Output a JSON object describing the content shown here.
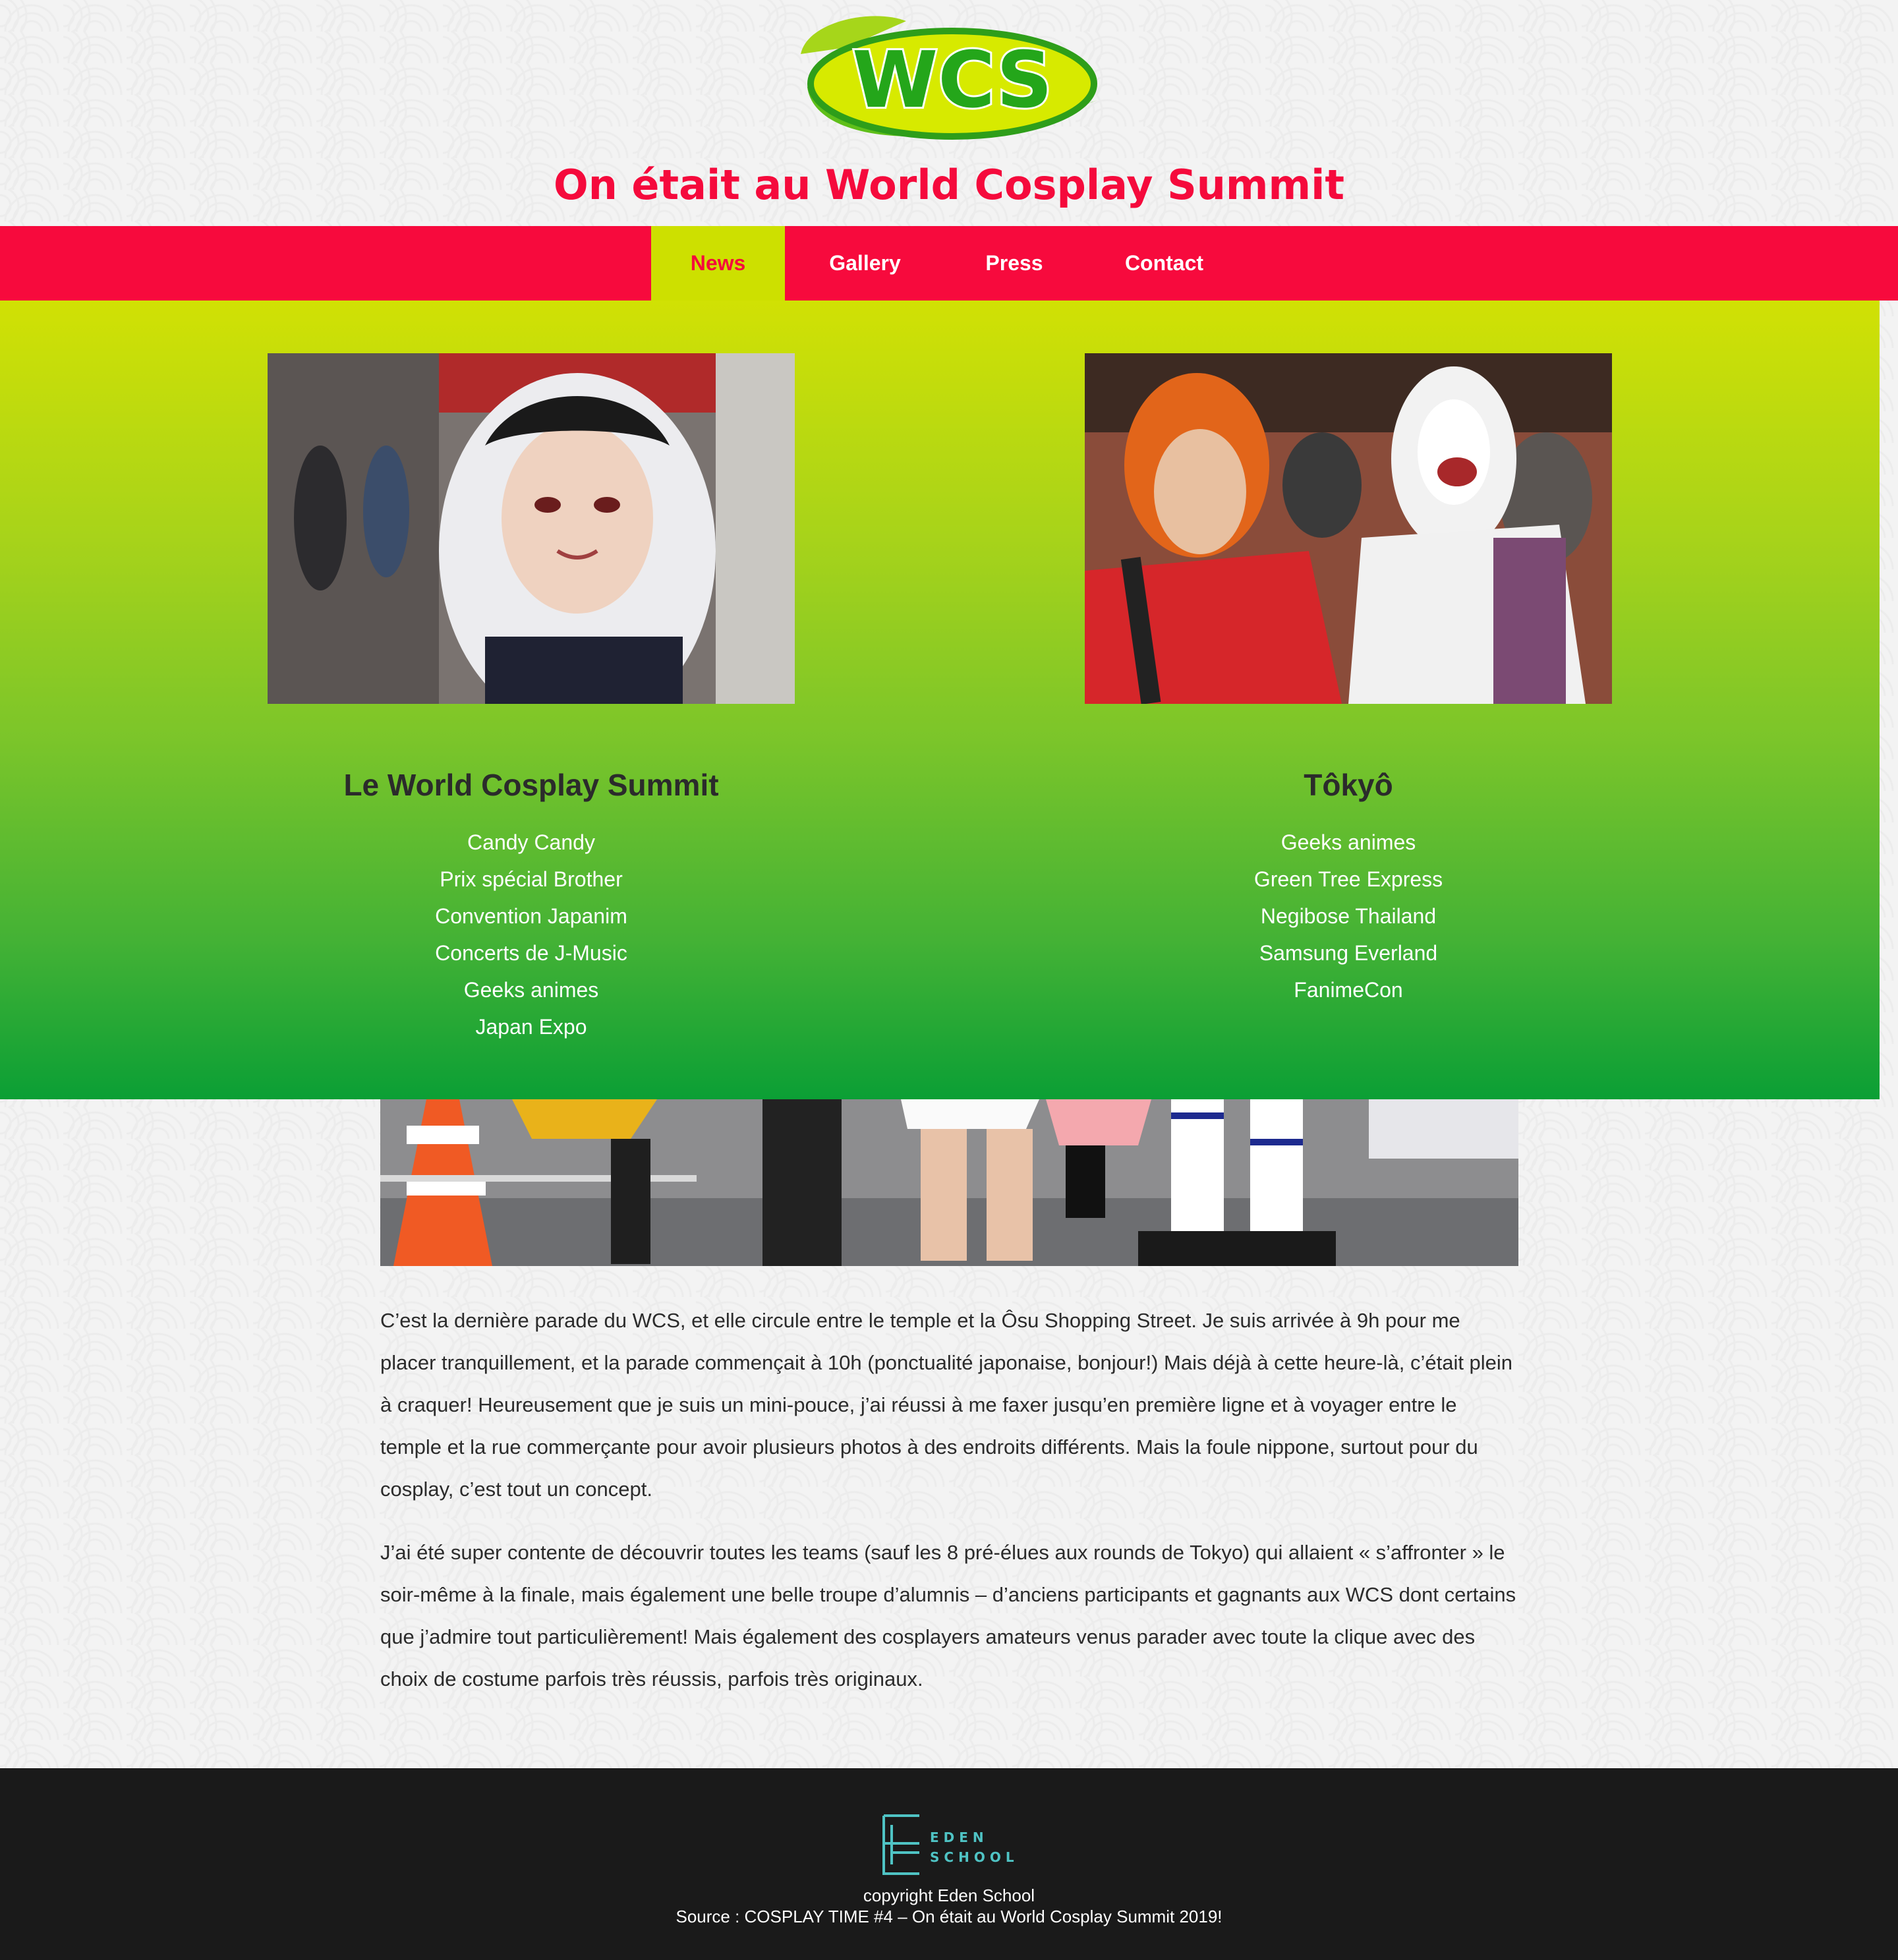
{
  "header": {
    "logo_text": "WCS",
    "title": "On était au World Cosplay Summit"
  },
  "nav": {
    "items": [
      {
        "label": "News",
        "active": true
      },
      {
        "label": "Gallery",
        "active": false
      },
      {
        "label": "Press",
        "active": false
      },
      {
        "label": "Contact",
        "active": false
      }
    ]
  },
  "cards": [
    {
      "title": "Le World Cosplay Summit",
      "links": [
        "Candy Candy",
        "Prix spécial Brother",
        "Convention Japanim",
        "Concerts de J-Music",
        "Geeks animes",
        "Japan Expo"
      ]
    },
    {
      "title": "Tôkyô",
      "links": [
        "Geeks animes",
        "Green Tree Express",
        "Negibose Thailand",
        "Samsung Everland",
        "FanimeCon"
      ]
    }
  ],
  "article": {
    "paragraphs": [
      "C’est la dernière parade du WCS, et elle circule entre le temple et la Ôsu Shopping Street. Je suis arrivée à 9h pour me placer tranquillement, et la parade commençait à 10h (ponctualité japonaise, bonjour!) Mais déjà à cette heure-là, c’était plein à craquer! Heureusement que je suis un mini-pouce, j’ai réussi à me faxer jusqu’en première ligne et à voyager entre le temple et la rue commerçante pour avoir plusieurs photos à des endroits différents. Mais la foule nippone, surtout pour du cosplay, c’est tout un concept.",
      "J’ai été super contente de découvrir toutes les teams (sauf les 8 pré-élues aux rounds de Tokyo) qui allaient « s’affronter » le soir-même à la finale, mais également une belle troupe d’alumnis – d’anciens participants et gagnants aux WCS dont certains que j’admire tout particulièrement! Mais également des cosplayers amateurs venus parader avec toute la clique avec des choix de costume parfois très réussis, parfois très originaux."
    ]
  },
  "footer": {
    "logo_line1": "EDEN",
    "logo_line2": "SCHOOL",
    "copyright": "copyright Eden School",
    "source": "Source : COSPLAY TIME #4 – On était au World Cosplay Summit 2019!"
  },
  "colors": {
    "accent_red": "#f70a3d",
    "accent_lime": "#cde000",
    "panel_green": "#0b9f35",
    "footer_bg": "#1a1a1a"
  }
}
